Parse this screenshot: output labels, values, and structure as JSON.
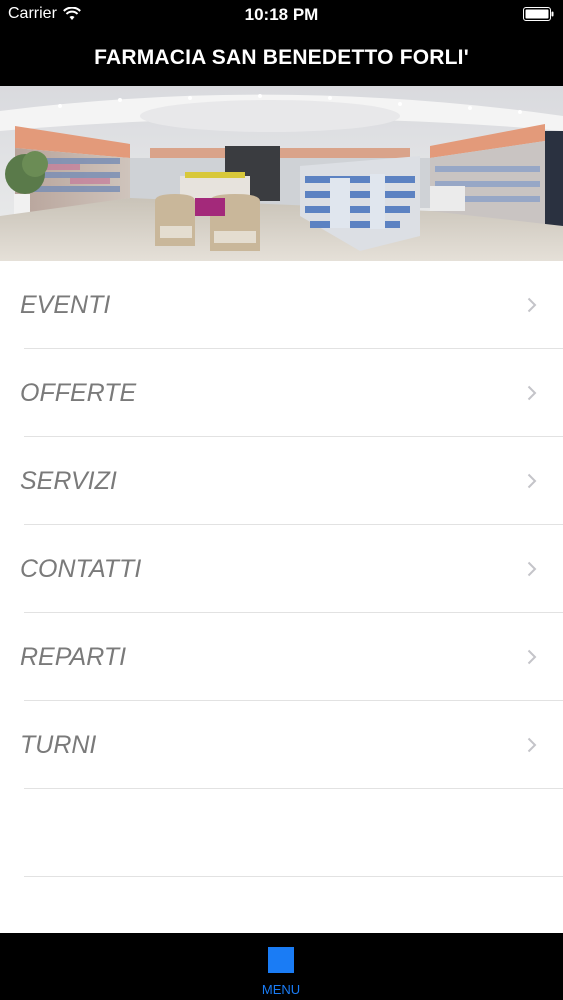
{
  "status_bar": {
    "carrier": "Carrier",
    "time": "10:18 PM"
  },
  "nav": {
    "title": "FARMACIA SAN BENEDETTO FORLI'"
  },
  "menu": {
    "items": [
      {
        "label": "EVENTI"
      },
      {
        "label": "OFFERTE"
      },
      {
        "label": "SERVIZI"
      },
      {
        "label": "CONTATTI"
      },
      {
        "label": "REPARTI"
      },
      {
        "label": "TURNI"
      }
    ]
  },
  "tab_bar": {
    "active_tab_label": "MENU",
    "accent_color": "#1a7cf5"
  },
  "icons": {
    "status": [
      "wifi-icon",
      "battery-icon"
    ],
    "menu_row": "chevron-right-icon",
    "tab": "menu-tab-icon"
  }
}
